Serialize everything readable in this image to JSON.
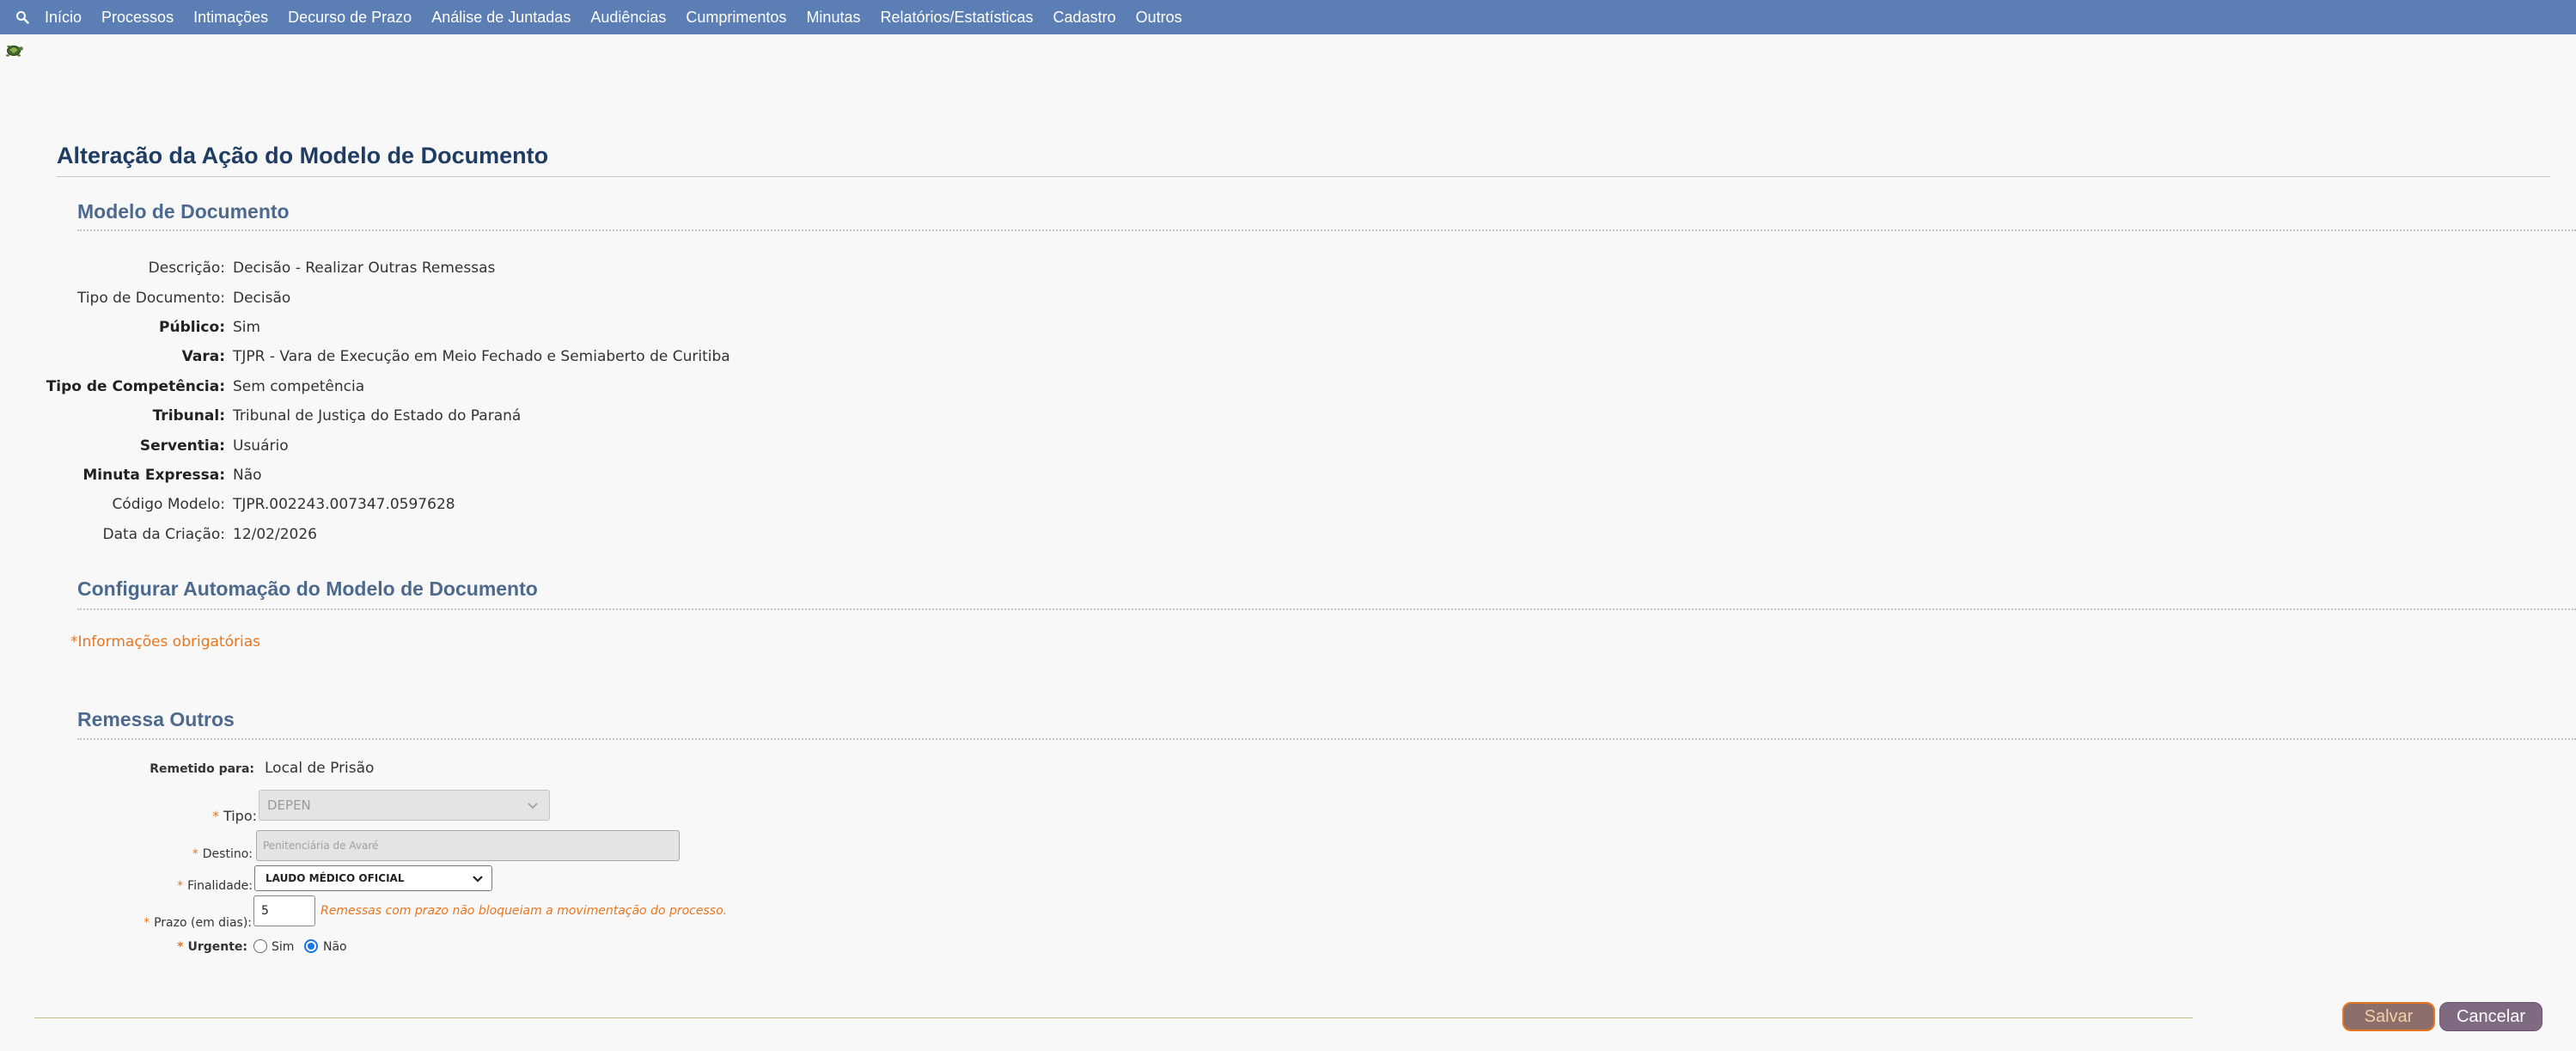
{
  "menu": {
    "items": [
      "Início",
      "Processos",
      "Intimações",
      "Decurso de Prazo",
      "Análise de Juntadas",
      "Audiências",
      "Cumprimentos",
      "Minutas",
      "Relatórios/Estatísticas",
      "Cadastro",
      "Outros"
    ]
  },
  "page_title": "Alteração da Ação do Modelo de Documento",
  "modelo": {
    "section_title": "Modelo de Documento",
    "descricao": {
      "label": "Descrição:",
      "value": "Decisão - Realizar Outras Remessas"
    },
    "tipo_documento": {
      "label": "Tipo de Documento:",
      "value": "Decisão"
    },
    "publico": {
      "label": "Público:",
      "value": "Sim"
    },
    "vara": {
      "label": "Vara:",
      "value": "TJPR - Vara de Execução em Meio Fechado e Semiaberto de Curitiba"
    },
    "tipo_competencia": {
      "label": "Tipo de Competência:",
      "value": "Sem competência"
    },
    "tribunal": {
      "label": "Tribunal:",
      "value": "Tribunal de Justiça do Estado do Paraná"
    },
    "serventia": {
      "label": "Serventia:",
      "value": "Usuário"
    },
    "minuta_expressa": {
      "label": "Minuta Expressa:",
      "value": "Não"
    },
    "codigo_modelo": {
      "label": "Código Modelo:",
      "value": "TJPR.002243.007347.0597628"
    },
    "data_criacao": {
      "label": "Data da Criação:",
      "value": "12/02/2026"
    }
  },
  "automacao": {
    "section_title": "Configurar Automação do Modelo de Documento",
    "required_note": "*Informações obrigatórias"
  },
  "remessa": {
    "section_title": "Remessa Outros",
    "remetido_label": "Remetido para:",
    "remetido_value": "Local de Prisão",
    "tipo_label": "Tipo:",
    "tipo_value": "DEPEN",
    "destino_label": "Destino:",
    "destino_value": "Penitenciária de Avaré",
    "finalidade_label": "Finalidade:",
    "finalidade_value": "LAUDO MÉDICO OFICIAL",
    "prazo_label": "Prazo (em dias):",
    "prazo_value": "5",
    "prazo_hint": "Remessas com prazo não bloqueiam a movimentação do processo.",
    "urgente_label": "Urgente:",
    "urgente_sim": "Sim",
    "urgente_nao": "Não"
  },
  "required_star": "*",
  "buttons": {
    "salvar": "Salvar",
    "cancelar": "Cancelar"
  },
  "colors": {
    "topbar": "#5b7fb4",
    "title": "#1f3c63",
    "section": "#4d6a8e",
    "required": "#e8761e"
  }
}
